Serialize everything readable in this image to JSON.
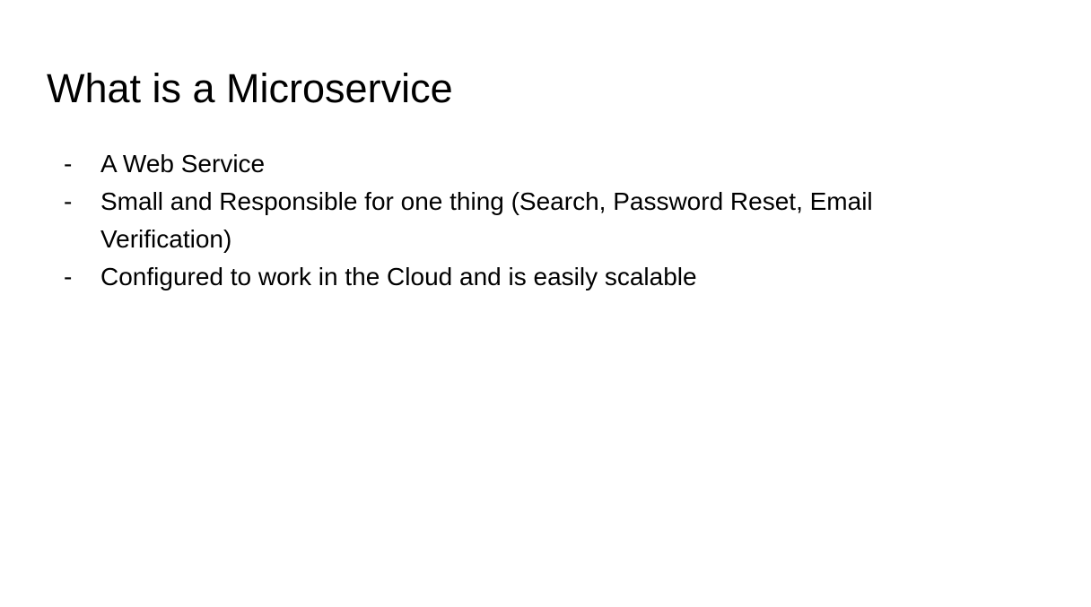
{
  "slide": {
    "title": "What is a Microservice",
    "bullet_marker": "-",
    "bullets": [
      "A Web Service",
      "Small and Responsible for one thing (Search, Password Reset, Email Verification)",
      "Configured to work in the Cloud and is easily scalable"
    ]
  },
  "colors": {
    "background": "#ffffff",
    "text": "#000000"
  }
}
